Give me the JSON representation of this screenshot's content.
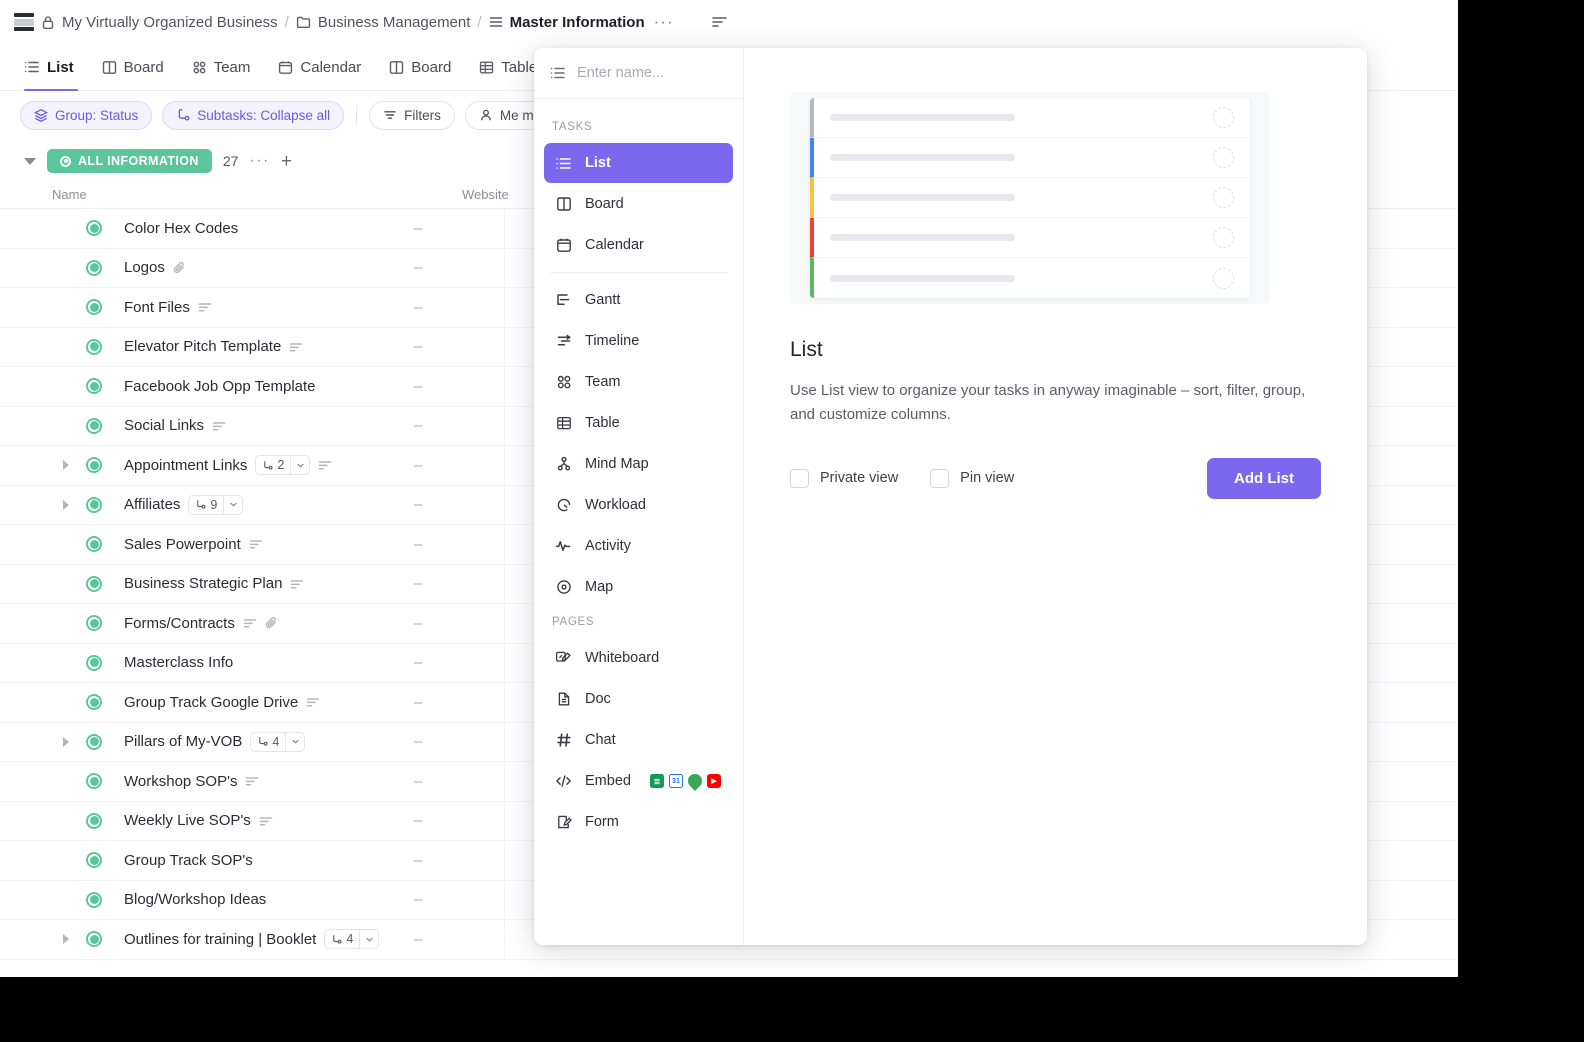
{
  "breadcrumb": {
    "logo_icon": "workspace-logo-icon",
    "lock_icon": "lock-icon",
    "workspace": "My Virtually Organized Business",
    "sep": "/",
    "folder_icon": "folder-icon",
    "folder": "Business Management",
    "list_icon": "list-lines-icon",
    "current": "Master Information",
    "more_label": "···",
    "right_icon": "sort-lines-icon"
  },
  "tabs": [
    {
      "label": "List",
      "icon": "list-icon",
      "active": true
    },
    {
      "label": "Board",
      "icon": "board-icon",
      "active": false
    },
    {
      "label": "Team",
      "icon": "team-icon",
      "active": false
    },
    {
      "label": "Calendar",
      "icon": "calendar-icon",
      "active": false
    },
    {
      "label": "Board",
      "icon": "board-icon",
      "active": false
    },
    {
      "label": "Table",
      "icon": "table-icon",
      "active": false
    }
  ],
  "filters": [
    {
      "label": "Group: Status",
      "icon": "layers-icon",
      "accent": true
    },
    {
      "label": "Subtasks: Collapse all",
      "icon": "subtask-icon",
      "accent": true
    },
    {
      "label": "Filters",
      "icon": "filter-icon",
      "accent": false
    },
    {
      "label": "Me mode",
      "icon": "person-icon",
      "accent": false
    }
  ],
  "group": {
    "caret_icon": "caret-down-icon",
    "status_label": "ALL INFORMATION",
    "status_color": "#5bc69b",
    "count": "27",
    "more_label": "···",
    "add_label": "+"
  },
  "table": {
    "columns": [
      "Name",
      "Website"
    ],
    "empty_value": "–",
    "rows": [
      {
        "name": "Color Hex Codes",
        "expandable": false,
        "desc": false,
        "attach": false,
        "subtasks": null
      },
      {
        "name": "Logos",
        "expandable": false,
        "desc": false,
        "attach": true,
        "subtasks": null
      },
      {
        "name": "Font Files",
        "expandable": false,
        "desc": true,
        "attach": false,
        "subtasks": null
      },
      {
        "name": "Elevator Pitch Template",
        "expandable": false,
        "desc": true,
        "attach": false,
        "subtasks": null
      },
      {
        "name": "Facebook Job Opp Template",
        "expandable": false,
        "desc": false,
        "attach": false,
        "subtasks": null
      },
      {
        "name": "Social Links",
        "expandable": false,
        "desc": true,
        "attach": false,
        "subtasks": null
      },
      {
        "name": "Appointment Links",
        "expandable": true,
        "desc": true,
        "attach": false,
        "subtasks": "2"
      },
      {
        "name": "Affiliates",
        "expandable": true,
        "desc": false,
        "attach": false,
        "subtasks": "9"
      },
      {
        "name": "Sales Powerpoint",
        "expandable": false,
        "desc": true,
        "attach": false,
        "subtasks": null
      },
      {
        "name": "Business Strategic Plan",
        "expandable": false,
        "desc": true,
        "attach": false,
        "subtasks": null
      },
      {
        "name": "Forms/Contracts",
        "expandable": false,
        "desc": true,
        "attach": true,
        "subtasks": null
      },
      {
        "name": "Masterclass Info",
        "expandable": false,
        "desc": false,
        "attach": false,
        "subtasks": null
      },
      {
        "name": "Group Track Google Drive",
        "expandable": false,
        "desc": true,
        "attach": false,
        "subtasks": null
      },
      {
        "name": "Pillars of My-VOB",
        "expandable": true,
        "desc": false,
        "attach": false,
        "subtasks": "4"
      },
      {
        "name": "Workshop SOP's",
        "expandable": false,
        "desc": true,
        "attach": false,
        "subtasks": null
      },
      {
        "name": "Weekly Live SOP's",
        "expandable": false,
        "desc": true,
        "attach": false,
        "subtasks": null
      },
      {
        "name": "Group Track SOP's",
        "expandable": false,
        "desc": false,
        "attach": false,
        "subtasks": null
      },
      {
        "name": "Blog/Workshop Ideas",
        "expandable": false,
        "desc": false,
        "attach": false,
        "subtasks": null
      },
      {
        "name": "Outlines for training | Booklet",
        "expandable": true,
        "desc": false,
        "attach": false,
        "subtasks": "4"
      }
    ]
  },
  "popup": {
    "name_placeholder": "Enter name...",
    "name_icon": "list-icon",
    "sections": [
      {
        "title": "TASKS",
        "items": [
          {
            "label": "List",
            "icon": "list-icon",
            "selected": true
          },
          {
            "label": "Board",
            "icon": "board-icon",
            "selected": false
          },
          {
            "label": "Calendar",
            "icon": "calendar-icon",
            "selected": false
          },
          {
            "rule": true
          },
          {
            "label": "Gantt",
            "icon": "gantt-icon",
            "selected": false
          },
          {
            "label": "Timeline",
            "icon": "timeline-icon",
            "selected": false
          },
          {
            "label": "Team",
            "icon": "team-icon",
            "selected": false
          },
          {
            "label": "Table",
            "icon": "table-icon",
            "selected": false
          },
          {
            "label": "Mind Map",
            "icon": "mindmap-icon",
            "selected": false
          },
          {
            "label": "Workload",
            "icon": "workload-icon",
            "selected": false
          },
          {
            "label": "Activity",
            "icon": "activity-icon",
            "selected": false
          },
          {
            "label": "Map",
            "icon": "map-pin-icon",
            "selected": false
          }
        ]
      },
      {
        "title": "PAGES",
        "items": [
          {
            "label": "Whiteboard",
            "icon": "whiteboard-icon",
            "selected": false
          },
          {
            "label": "Doc",
            "icon": "doc-icon",
            "selected": false
          },
          {
            "label": "Chat",
            "icon": "hash-icon",
            "selected": false
          },
          {
            "label": "Embed",
            "icon": "code-icon",
            "selected": false,
            "apps": [
              {
                "name": "google-sheets-icon",
                "color": "#0f9d58",
                "glyph": "≣"
              },
              {
                "name": "google-calendar-icon",
                "color": "#1a73e8",
                "glyph": "31"
              },
              {
                "name": "google-maps-icon",
                "color": "#34a853",
                "glyph": "●"
              },
              {
                "name": "youtube-icon",
                "color": "#ff0000",
                "glyph": "▶"
              }
            ]
          },
          {
            "label": "Form",
            "icon": "form-icon",
            "selected": false
          }
        ]
      }
    ],
    "preview": {
      "row_colors": [
        "#b6b6bb",
        "#4285f4",
        "#f6c344",
        "#ea4335",
        "#5cb85c"
      ],
      "row_count": 5
    },
    "title": "List",
    "description": "Use List view to organize your tasks in anyway imaginable – sort, filter, group, and customize columns.",
    "private_view_label": "Private view",
    "pin_view_label": "Pin view",
    "add_button_label": "Add List",
    "accent_color": "#7b68ee"
  }
}
